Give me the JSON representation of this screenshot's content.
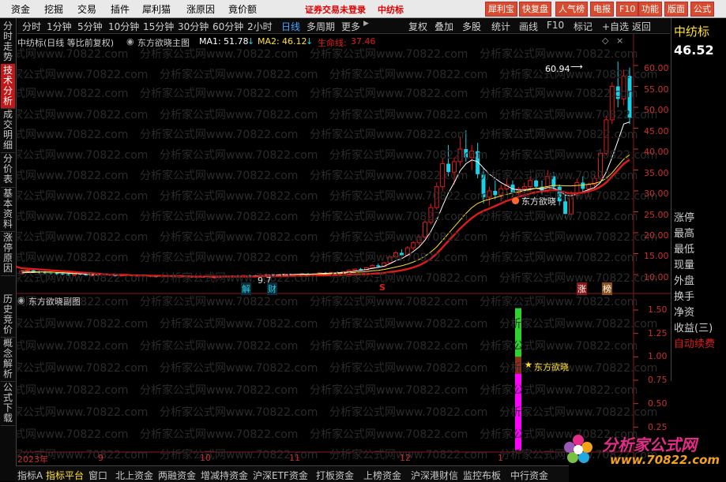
{
  "menu": {
    "items": [
      "资金",
      "挖掘",
      "交易",
      "插件",
      "犀利猫",
      "涨原因",
      "竟价额"
    ],
    "login_notice": "证券交易未登录",
    "stock_name_top": "中纺标",
    "right_buttons": [
      "犀利宝",
      "快复盘",
      "人气榜",
      "电报",
      "F10",
      "功能",
      "版面",
      "公式"
    ]
  },
  "toolbar": {
    "periods": [
      "分时",
      "1分钟",
      "5分钟",
      "10分钟",
      "15分钟",
      "30分钟",
      "60分钟",
      "2小时",
      "日线",
      "多周期",
      "更多"
    ],
    "active_period": "日线",
    "buttons": [
      "复权",
      "叠加",
      "多股",
      "统计",
      "画线",
      "F10",
      "标记",
      "+自选",
      "返回"
    ]
  },
  "left_tabs": [
    "分时走势",
    "技术分析",
    "成交明细",
    "分价表",
    "基本资料",
    "涨停原因",
    "历史竞价",
    "概念解析",
    "公式下载"
  ],
  "main_chart": {
    "legend_name": "中纺标(日线 等比前复权)",
    "indicator": "东方欲晓主图",
    "ma1_label": "MA1:",
    "ma1_value": "51.78",
    "ma2_label": "MA2:",
    "ma2_value": "46.12",
    "life_label": "生命线:",
    "life_value": "37.46",
    "high_label": "60.94",
    "mark_text": "东方欲晓",
    "low_label": "9.7",
    "markers": {
      "jie": "解",
      "cai": "财",
      "s": "S",
      "zhang": "涨",
      "bang": "榜"
    }
  },
  "sub_chart": {
    "title": "东方欲晓副图",
    "star_text": "东方欲晓",
    "y_ticks": [
      "1.50",
      "1.25",
      "1.00",
      "0.75",
      "0.50",
      "0.25"
    ]
  },
  "chart_data": {
    "type": "candlestick",
    "y_ticks": [
      "60.00",
      "55.00",
      "50.00",
      "45.00",
      "40.00",
      "35.00",
      "30.00",
      "25.00",
      "20.00",
      "15.00",
      "10.00"
    ],
    "ylim": [
      9,
      62
    ],
    "date_labels": [
      "2023年",
      "9",
      "10",
      "11",
      "12",
      "1"
    ],
    "candles": [
      [
        10.2,
        11.1,
        9.9,
        10.8
      ],
      [
        10.9,
        11.5,
        10.5,
        11.0
      ],
      [
        11.0,
        11.2,
        10.4,
        10.6
      ],
      [
        10.6,
        10.9,
        10.2,
        10.5
      ],
      [
        10.5,
        10.8,
        10.1,
        10.4
      ],
      [
        10.4,
        10.7,
        10.0,
        10.3
      ],
      [
        10.3,
        10.6,
        9.9,
        10.2
      ],
      [
        10.2,
        10.5,
        9.8,
        10.1
      ],
      [
        10.1,
        10.4,
        9.7,
        9.9
      ],
      [
        9.9,
        10.3,
        9.6,
        10.2
      ],
      [
        10.2,
        10.4,
        9.8,
        10.0
      ],
      [
        10.0,
        10.3,
        9.7,
        9.8
      ],
      [
        9.8,
        10.1,
        9.5,
        9.9
      ],
      [
        9.9,
        10.2,
        9.6,
        10.1
      ],
      [
        10.1,
        10.3,
        9.8,
        10.0
      ],
      [
        10.0,
        10.2,
        9.7,
        9.8
      ],
      [
        9.8,
        10.0,
        9.5,
        9.7
      ],
      [
        9.7,
        10.0,
        9.4,
        9.9
      ],
      [
        9.9,
        10.1,
        9.6,
        9.8
      ],
      [
        9.8,
        10.0,
        9.5,
        9.6
      ],
      [
        9.6,
        9.9,
        9.3,
        9.8
      ],
      [
        9.8,
        10.0,
        9.5,
        9.7
      ],
      [
        9.7,
        9.9,
        9.4,
        9.6
      ],
      [
        9.6,
        9.8,
        9.3,
        9.5
      ],
      [
        9.5,
        9.8,
        9.2,
        9.7
      ],
      [
        9.7,
        9.9,
        9.4,
        9.6
      ],
      [
        9.6,
        9.8,
        9.3,
        9.4
      ],
      [
        9.4,
        9.7,
        9.1,
        9.6
      ],
      [
        9.6,
        9.8,
        9.4,
        9.5
      ],
      [
        9.5,
        9.7,
        9.2,
        9.3
      ],
      [
        9.3,
        9.6,
        9.1,
        9.5
      ],
      [
        9.5,
        9.7,
        9.3,
        9.4
      ],
      [
        9.4,
        9.6,
        9.2,
        9.3
      ],
      [
        9.3,
        9.5,
        9.0,
        9.4
      ],
      [
        9.4,
        9.7,
        9.2,
        9.6
      ],
      [
        9.6,
        9.8,
        9.3,
        9.5
      ],
      [
        9.5,
        9.8,
        9.3,
        9.7
      ],
      [
        9.7,
        9.9,
        9.5,
        9.6
      ],
      [
        9.6,
        9.9,
        9.4,
        9.8
      ],
      [
        9.8,
        10.0,
        9.6,
        9.7
      ],
      [
        9.7,
        9.9,
        9.5,
        9.6
      ],
      [
        9.6,
        9.9,
        9.4,
        9.8
      ],
      [
        9.8,
        10.1,
        9.6,
        10.0
      ],
      [
        10.0,
        10.2,
        9.7,
        9.9
      ],
      [
        9.9,
        10.1,
        9.7,
        10.0
      ],
      [
        10.0,
        10.3,
        9.8,
        10.1
      ],
      [
        10.1,
        10.2,
        9.8,
        9.9
      ],
      [
        9.9,
        10.2,
        9.7,
        10.1
      ],
      [
        10.1,
        10.4,
        9.9,
        10.2
      ],
      [
        10.2,
        10.4,
        10.0,
        10.1
      ],
      [
        10.1,
        10.3,
        9.9,
        10.2
      ],
      [
        10.2,
        10.5,
        10.0,
        10.4
      ],
      [
        10.4,
        10.6,
        10.1,
        10.3
      ],
      [
        10.3,
        10.6,
        10.1,
        10.5
      ],
      [
        10.5,
        10.7,
        10.2,
        10.4
      ],
      [
        10.4,
        10.8,
        10.2,
        10.7
      ],
      [
        10.7,
        11.2,
        10.5,
        11.0
      ],
      [
        11.0,
        11.5,
        10.8,
        11.3
      ],
      [
        11.3,
        11.6,
        10.9,
        11.1
      ],
      [
        11.1,
        11.8,
        11.0,
        11.6
      ],
      [
        11.6,
        12.4,
        11.4,
        12.2
      ],
      [
        12.2,
        12.6,
        11.6,
        11.9
      ],
      [
        11.9,
        13.0,
        11.8,
        12.8
      ],
      [
        12.8,
        14.5,
        12.6,
        14.2
      ],
      [
        14.2,
        15.6,
        13.8,
        15.2
      ],
      [
        15.2,
        16.0,
        14.0,
        14.6
      ],
      [
        14.6,
        16.8,
        14.4,
        16.4
      ],
      [
        16.4,
        18.0,
        15.8,
        17.6
      ],
      [
        17.6,
        19.5,
        17.0,
        19.0
      ],
      [
        19.0,
        23.0,
        18.5,
        22.5
      ],
      [
        22.5,
        27.0,
        22.0,
        26.0
      ],
      [
        26.0,
        32.0,
        25.5,
        31.0
      ],
      [
        31.0,
        38.0,
        30.0,
        36.5
      ],
      [
        36.5,
        41.0,
        33.5,
        34.5
      ],
      [
        34.5,
        38.0,
        31.5,
        37.0
      ],
      [
        37.0,
        43.0,
        36.0,
        40.0
      ],
      [
        40.0,
        44.5,
        37.0,
        38.0
      ],
      [
        38.0,
        41.0,
        35.0,
        39.5
      ],
      [
        39.5,
        41.5,
        33.0,
        34.0
      ],
      [
        34.0,
        35.5,
        27.0,
        28.5
      ],
      [
        28.5,
        31.0,
        26.5,
        30.0
      ],
      [
        30.0,
        32.5,
        28.0,
        29.0
      ],
      [
        29.0,
        31.5,
        27.5,
        30.5
      ],
      [
        30.5,
        33.0,
        29.5,
        31.5
      ],
      [
        31.5,
        32.5,
        28.5,
        29.5
      ],
      [
        29.5,
        31.0,
        28.0,
        30.5
      ],
      [
        30.5,
        32.0,
        29.5,
        31.0
      ],
      [
        31.0,
        33.5,
        30.0,
        32.5
      ],
      [
        32.5,
        34.0,
        30.5,
        31.0
      ],
      [
        31.0,
        32.5,
        29.0,
        30.0
      ],
      [
        30.0,
        35.0,
        29.5,
        33.5
      ],
      [
        33.5,
        34.5,
        30.0,
        31.0
      ],
      [
        31.0,
        31.5,
        26.5,
        27.5
      ],
      [
        27.5,
        29.0,
        23.5,
        24.5
      ],
      [
        24.5,
        30.0,
        24.0,
        29.0
      ],
      [
        29.0,
        33.0,
        28.5,
        32.0
      ],
      [
        32.0,
        33.5,
        29.5,
        30.5
      ],
      [
        30.5,
        32.0,
        28.5,
        31.5
      ],
      [
        31.5,
        34.0,
        30.5,
        33.0
      ],
      [
        33.0,
        40.0,
        32.5,
        39.0
      ],
      [
        39.0,
        48.0,
        38.5,
        47.0
      ],
      [
        47.0,
        56.0,
        46.0,
        55.0
      ],
      [
        55.0,
        60.94,
        50.0,
        52.0
      ],
      [
        52.0,
        59.0,
        50.5,
        57.5
      ],
      [
        57.5,
        59.5,
        46.0,
        47.5
      ]
    ],
    "ma1": [
      10.4,
      10.5,
      10.5,
      10.6,
      10.6,
      10.5,
      10.4,
      10.4,
      10.3,
      10.2,
      10.2,
      10.1,
      10.0,
      10.0,
      10.0,
      9.9,
      9.9,
      9.8,
      9.8,
      9.8,
      9.8,
      9.7,
      9.7,
      9.7,
      9.6,
      9.6,
      9.6,
      9.5,
      9.5,
      9.5,
      9.5,
      9.4,
      9.4,
      9.4,
      9.4,
      9.5,
      9.5,
      9.6,
      9.6,
      9.6,
      9.7,
      9.7,
      9.8,
      9.8,
      9.9,
      10.0,
      10.0,
      10.0,
      10.1,
      10.1,
      10.1,
      10.2,
      10.3,
      10.3,
      10.4,
      10.5,
      10.6,
      10.8,
      11.0,
      11.2,
      11.5,
      11.7,
      12.0,
      12.6,
      13.3,
      13.8,
      14.6,
      15.5,
      16.6,
      18.2,
      20.3,
      23.0,
      26.4,
      29.5,
      32.0,
      34.8,
      36.5,
      37.4,
      37.0,
      35.5,
      34.0,
      33.0,
      32.0,
      31.2,
      30.5,
      30.2,
      30.2,
      30.5,
      30.6,
      30.4,
      30.8,
      30.7,
      30.0,
      29.0,
      28.8,
      29.3,
      29.8,
      30.3,
      30.8,
      32.0,
      34.5,
      38.0,
      42.0,
      46.0,
      46.5
    ],
    "ma2": [
      10.8,
      10.7,
      10.7,
      10.6,
      10.6,
      10.6,
      10.5,
      10.5,
      10.4,
      10.4,
      10.3,
      10.3,
      10.2,
      10.2,
      10.1,
      10.1,
      10.0,
      10.0,
      9.9,
      9.9,
      9.9,
      9.8,
      9.8,
      9.8,
      9.7,
      9.7,
      9.7,
      9.6,
      9.6,
      9.6,
      9.6,
      9.5,
      9.5,
      9.5,
      9.5,
      9.5,
      9.5,
      9.6,
      9.6,
      9.6,
      9.6,
      9.7,
      9.7,
      9.7,
      9.8,
      9.8,
      9.8,
      9.9,
      9.9,
      10.0,
      10.0,
      10.1,
      10.1,
      10.2,
      10.2,
      10.3,
      10.4,
      10.5,
      10.6,
      10.7,
      10.9,
      11.0,
      11.2,
      11.5,
      11.8,
      12.1,
      12.5,
      13.0,
      13.6,
      14.4,
      15.4,
      16.6,
      18.2,
      19.8,
      21.4,
      23.0,
      24.6,
      26.0,
      27.0,
      27.6,
      28.0,
      28.4,
      28.8,
      29.2,
      29.5,
      29.8,
      30.0,
      30.3,
      30.6,
      30.8,
      31.1,
      31.3,
      31.3,
      31.2,
      31.2,
      31.3,
      31.4,
      31.6,
      31.8,
      32.2,
      33.0,
      34.3,
      36.0,
      37.6,
      38.6
    ],
    "life": [
      11.5,
      11.4,
      11.3,
      11.2,
      11.1,
      11.0,
      10.9,
      10.8,
      10.7,
      10.6,
      10.5,
      10.4,
      10.3,
      10.2,
      10.1,
      10.0,
      10.0,
      9.9,
      9.9,
      9.8,
      9.8,
      9.8,
      9.7,
      9.7,
      9.7,
      9.6,
      9.6,
      9.6,
      9.6,
      9.5,
      9.5,
      9.5,
      9.5,
      9.5,
      9.5,
      9.5,
      9.5,
      9.5,
      9.5,
      9.5,
      9.5,
      9.6,
      9.6,
      9.6,
      9.6,
      9.6,
      9.7,
      9.7,
      9.7,
      9.7,
      9.8,
      9.8,
      9.8,
      9.9,
      9.9,
      9.9,
      10.0,
      10.0,
      10.1,
      10.1,
      10.2,
      10.3,
      10.4,
      10.6,
      10.8,
      11.0,
      11.3,
      11.7,
      12.2,
      12.9,
      13.8,
      15.0,
      16.5,
      18.0,
      19.5,
      21.0,
      22.3,
      23.5,
      24.5,
      25.2,
      25.8,
      26.4,
      27.0,
      27.6,
      28.1,
      28.6,
      29.0,
      29.4,
      29.7,
      29.9,
      30.1,
      30.2,
      30.0,
      29.6,
      29.4,
      29.4,
      29.6,
      29.9,
      30.3,
      31.0,
      32.0,
      33.5,
      35.0,
      36.5,
      37.46
    ],
    "sub_bars": [
      {
        "from": 0.0,
        "to": 0.82,
        "color": "#ff00ff"
      },
      {
        "from": 0.82,
        "to": 1.0,
        "color": "#8b2f1a"
      },
      {
        "from": 1.0,
        "to": 1.52,
        "color": "#2ed12e"
      }
    ]
  },
  "right_panel": {
    "name": "中纺标",
    "price": "46.52",
    "rows": [
      "涨停",
      "最高",
      "最低",
      "现量",
      "外盘",
      "换手",
      "净资",
      "收益(三)"
    ],
    "auto_label": "自动续费"
  },
  "bottom_tabs": [
    "指标A",
    "指标平台",
    "窗口",
    "北上资金",
    "两融资金",
    "增减持资金",
    "沪深ETF资金",
    "打板资金",
    "上榜资金",
    "沪深港财信",
    "监控布板",
    "中行资金"
  ],
  "watermark": {
    "text": "分析家公式网www.70822.com",
    "logo_text": "分析家公式网",
    "logo_url": "www.70822.com"
  },
  "colors": {
    "red": "#e01b1b",
    "cyan": "#19d1e6",
    "yellow": "#ffe033",
    "white": "#ffffff",
    "axis": "#c83030"
  }
}
